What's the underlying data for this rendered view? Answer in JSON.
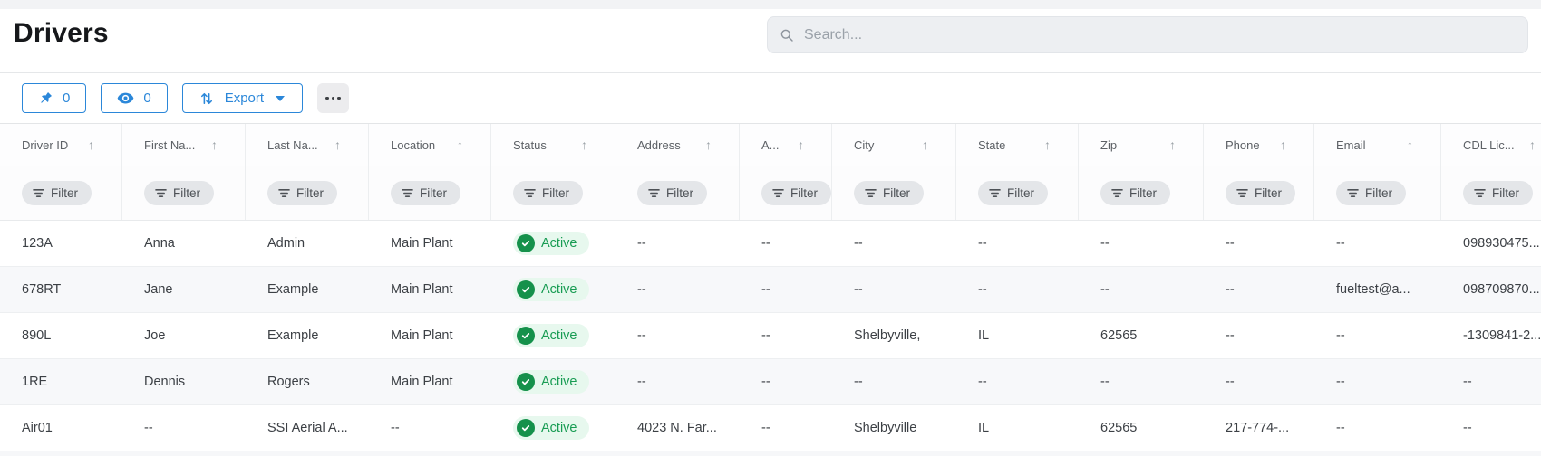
{
  "page": {
    "title": "Drivers"
  },
  "search": {
    "placeholder": "Search...",
    "icon": "magnifier"
  },
  "toolbar": {
    "pin_button": {
      "icon": "pushpin",
      "count": "0"
    },
    "eye_button": {
      "icon": "eye",
      "count": "0"
    },
    "export_button": {
      "icon": "up-down-arrows",
      "label": "Export",
      "caret_icon": "caret-down"
    },
    "more_button": {
      "icon": "ellipsis"
    }
  },
  "colors": {
    "accent_blue": "#2b87d9",
    "badge_green_circle": "#15914b",
    "badge_green_bg": "#e7f8ee",
    "badge_green_text": "#189c53",
    "zebra_row_bg": "#f7f8fa",
    "filter_pill_bg": "#e4e6e9",
    "search_bg": "#edeff2"
  },
  "icons": {
    "header_sort": "up-arrow",
    "filter_pill": "filter-lines",
    "status_check": "check-circle"
  },
  "table": {
    "filter_label": "Filter",
    "status_column_index": 4,
    "columns": [
      {
        "label": "Driver ID"
      },
      {
        "label": "First Na..."
      },
      {
        "label": "Last Na..."
      },
      {
        "label": "Location"
      },
      {
        "label": "Status"
      },
      {
        "label": "Address"
      },
      {
        "label": "A..."
      },
      {
        "label": "City"
      },
      {
        "label": "State"
      },
      {
        "label": "Zip"
      },
      {
        "label": "Phone"
      },
      {
        "label": "Email"
      },
      {
        "label": "CDL Lic..."
      }
    ],
    "rows": [
      {
        "cells": [
          "123A",
          "Anna",
          "Admin",
          "Main Plant",
          "Active",
          "--",
          "--",
          "--",
          "--",
          "--",
          "--",
          "--",
          "098930475..."
        ]
      },
      {
        "cells": [
          "678RT",
          "Jane",
          "Example",
          "Main Plant",
          "Active",
          "--",
          "--",
          "--",
          "--",
          "--",
          "--",
          "fueltest@a...",
          "098709870..."
        ]
      },
      {
        "cells": [
          "890L",
          "Joe",
          "Example",
          "Main Plant",
          "Active",
          "--",
          "--",
          "Shelbyville,",
          "IL",
          "62565",
          "--",
          "--",
          "-1309841-2..."
        ]
      },
      {
        "cells": [
          "1RE",
          "Dennis",
          "Rogers",
          "Main Plant",
          "Active",
          "--",
          "--",
          "--",
          "--",
          "--",
          "--",
          "--",
          "--"
        ]
      },
      {
        "cells": [
          "Air01",
          "--",
          "SSI Aerial A...",
          "--",
          "Active",
          "4023 N. Far...",
          "--",
          "Shelbyville",
          "IL",
          "62565",
          "217-774-...",
          "--",
          "--"
        ]
      }
    ]
  }
}
